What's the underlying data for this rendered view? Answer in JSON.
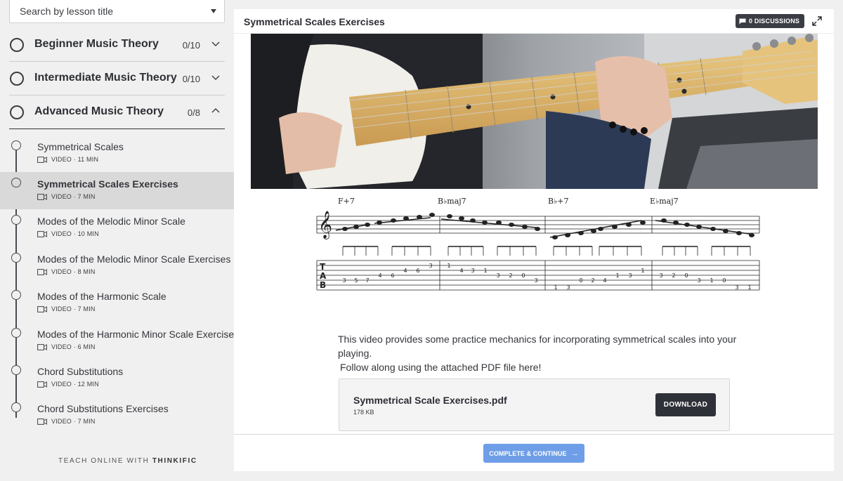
{
  "search": {
    "placeholder": "Search by lesson title"
  },
  "chapters": [
    {
      "title": "Beginner Music Theory",
      "progress": "0/10",
      "expanded": false
    },
    {
      "title": "Intermediate Music Theory",
      "progress": "0/10",
      "expanded": false
    },
    {
      "title": "Advanced Music Theory",
      "progress": "0/8",
      "expanded": true
    }
  ],
  "lessons": [
    {
      "title": "Symmetrical Scales",
      "meta": "VIDEO · 11 MIN",
      "active": false
    },
    {
      "title": "Symmetrical Scales Exercises",
      "meta": "VIDEO · 7 MIN",
      "active": true
    },
    {
      "title": "Modes of the Melodic Minor Scale",
      "meta": "VIDEO · 10 MIN",
      "active": false
    },
    {
      "title": "Modes of the Melodic Minor Scale Exercises",
      "meta": "VIDEO · 8 MIN",
      "active": false
    },
    {
      "title": "Modes of the Harmonic Scale",
      "meta": "VIDEO · 7 MIN",
      "active": false
    },
    {
      "title": "Modes of the Harmonic Minor Scale Exercises",
      "meta": "VIDEO · 6 MIN",
      "active": false
    },
    {
      "title": "Chord Substitutions",
      "meta": "VIDEO · 12 MIN",
      "active": false
    },
    {
      "title": "Chord Substitutions Exercises",
      "meta": "VIDEO · 7 MIN",
      "active": false
    }
  ],
  "brand": {
    "prefix": "TEACH ONLINE WITH",
    "name": "THINKIFIC"
  },
  "main": {
    "title": "Symmetrical Scales Exercises",
    "discussions": "0 DISCUSSIONS",
    "description_line1": "This video provides some practice mechanics for incorporating symmetrical scales into your playing.",
    "description_line2": "Follow along using the attached PDF file here!",
    "file": {
      "name": "Symmetrical Scale Exercises.pdf",
      "size": "178 KB",
      "download_label": "DOWNLOAD"
    },
    "complete_label": "COMPLETE & CONTINUE",
    "complete_arrow": "→"
  },
  "notation": {
    "chords": [
      "F+7",
      "B♭maj7",
      "B♭+7",
      "E♭maj7"
    ],
    "tab_letters": [
      "T",
      "A",
      "B"
    ],
    "tab_numbers": [
      "3",
      "5",
      "7",
      "4",
      "6",
      "4",
      "6",
      "3",
      "1",
      "4",
      "3",
      "1",
      "3",
      "2",
      "0",
      "3",
      "1",
      "3",
      "0",
      "2",
      "4",
      "1",
      "3",
      "1",
      "3",
      "2",
      "0",
      "3",
      "1",
      "0",
      "3",
      "1"
    ]
  },
  "colors": {
    "accent": "#6f9ee8",
    "dark_button": "#2f3139",
    "active_lesson_bg": "#d9d9d9",
    "sidebar_bg": "#f0f0f0"
  }
}
